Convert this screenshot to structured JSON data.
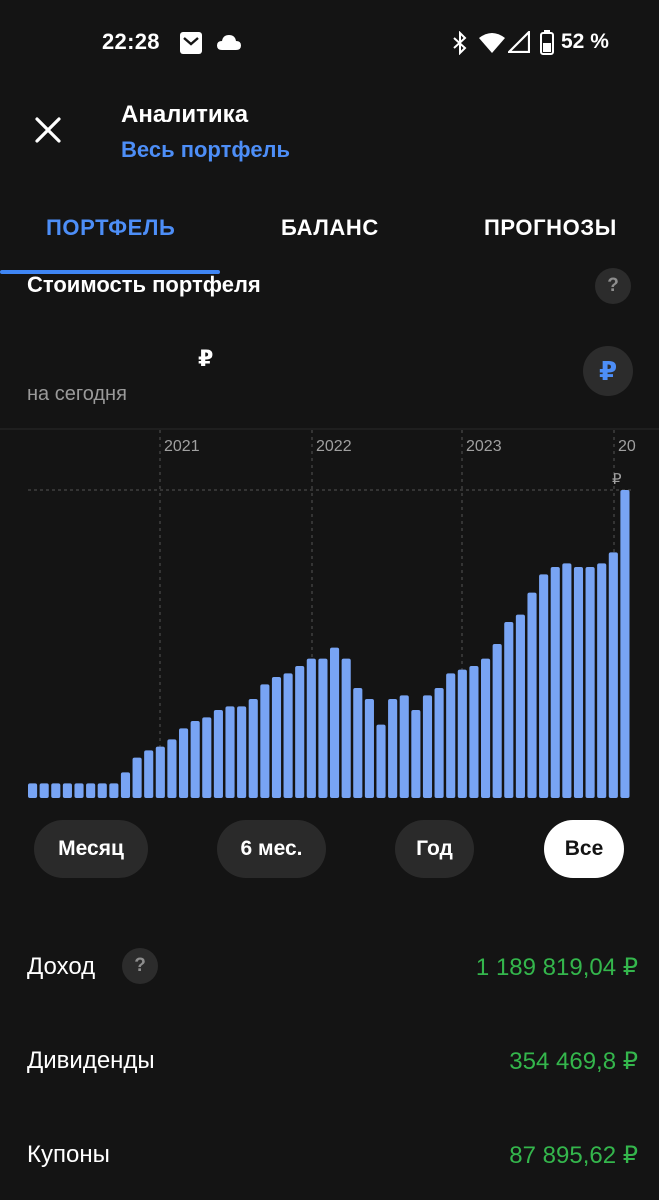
{
  "status_bar": {
    "time": "22:28",
    "battery_percent": "52 %",
    "icons": [
      "mail-icon",
      "cloud-icon",
      "bluetooth-icon",
      "wifi-icon",
      "signal-icon",
      "battery-icon"
    ]
  },
  "header": {
    "title": "Аналитика",
    "subtitle": "Весь портфель"
  },
  "tabs": [
    {
      "label": "ПОРТФЕЛЬ",
      "active": true
    },
    {
      "label": "БАЛАНС",
      "active": false
    },
    {
      "label": "ПРОГНОЗЫ",
      "active": false
    }
  ],
  "portfolio": {
    "title": "Стоимость портфеля",
    "help": "?",
    "currency_symbol": "₽",
    "as_of": "на сегодня",
    "currency_button": "₽"
  },
  "chart_data": {
    "type": "bar",
    "year_labels": [
      "2021",
      "2022",
      "2023",
      "20"
    ],
    "max_marker_label": "₽",
    "values": [
      4,
      4,
      4,
      4,
      4,
      4,
      4,
      4,
      7,
      11,
      13,
      14,
      16,
      19,
      21,
      22,
      24,
      25,
      25,
      27,
      31,
      33,
      34,
      36,
      38,
      38,
      41,
      38,
      30,
      27,
      20,
      27,
      28,
      24,
      28,
      30,
      34,
      35,
      36,
      38,
      42,
      48,
      50,
      56,
      61,
      63,
      64,
      63,
      63,
      64,
      67,
      84
    ],
    "grid": "dashed vertical year lines",
    "color": "#78a4f4"
  },
  "periods": [
    {
      "label": "Месяц",
      "active": false
    },
    {
      "label": "6 мес.",
      "active": false
    },
    {
      "label": "Год",
      "active": false
    },
    {
      "label": "Все",
      "active": true
    }
  ],
  "stats": [
    {
      "label": "Доход",
      "value": "1 189 819,04 ₽",
      "help": "?"
    },
    {
      "label": "Дивиденды",
      "value": "354 469,8 ₽"
    },
    {
      "label": "Купоны",
      "value": "87 895,62 ₽"
    }
  ],
  "colors": {
    "background": "#141414",
    "accent": "#4d8ef7",
    "positive": "#34b64c",
    "bar": "#78a4f4"
  }
}
